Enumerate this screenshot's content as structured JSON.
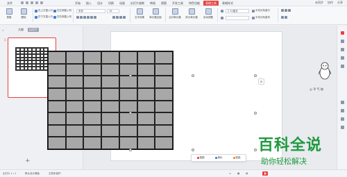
{
  "menubar": {
    "file_label": "文件",
    "tabs": [
      "开始",
      "插入",
      "设计",
      "切换",
      "动画",
      "幻灯片放映",
      "审阅",
      "视图",
      "开发工具",
      "特色功能",
      "表格工具",
      "表格样式"
    ],
    "active_tab_index": 10,
    "right_items": [
      "未同步",
      "协作",
      "分享"
    ],
    "accent_color": "#e8413e"
  },
  "ribbon": {
    "insert_above": "在上方插入行",
    "insert_below": "在下方插入行",
    "insert_left": "在左侧插入列",
    "insert_right": "在右侧插入列",
    "font_name": "宋体",
    "font_size": "18",
    "text_effect": "文字效果",
    "cell_align": "单元格边距",
    "merge_cells": "合并单元格",
    "split_cells": "拆分单元格",
    "auto_fit": "自动调整",
    "height_value": "2.32厘米",
    "width_value": "",
    "distribute_rows": "平均分布各行",
    "distribute_cols": "平均分布各列",
    "delete_label": "删除",
    "table_label": "表格"
  },
  "left_panel": {
    "tab_outline": "大纲",
    "tab_slides": "幻灯片",
    "slide_number": "1"
  },
  "table_toolbar": {
    "items": [
      "插图",
      "美化",
      "智能"
    ]
  },
  "statusbar": {
    "slide_info": "幻灯片 1 / 1",
    "theme": "默认设计模板",
    "backup": "文档未保护"
  },
  "watermark": {
    "title": "百科全说",
    "subtitle": "助你轻松解决",
    "motto": "心 平 气 和"
  },
  "table": {
    "rows": 8,
    "cols": 7,
    "fill_color": "#a8a8a8"
  }
}
